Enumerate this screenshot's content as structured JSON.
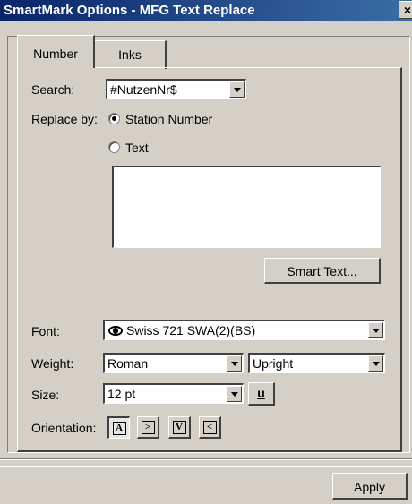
{
  "window": {
    "title": "SmartMark Options - MFG Text Replace",
    "close_label": "×"
  },
  "tabs": [
    {
      "label": "Number",
      "active": true
    },
    {
      "label": "Inks",
      "active": false
    }
  ],
  "search": {
    "label": "Search:",
    "value": "#NutzenNr$"
  },
  "replace_by": {
    "label": "Replace by:",
    "options": [
      {
        "label": "Station Number",
        "selected": true
      },
      {
        "label": "Text",
        "selected": false
      }
    ],
    "text_value": ""
  },
  "smart_text_button": "Smart Text...",
  "font": {
    "label": "Font:",
    "value": "Swiss 721 SWA(2)(BS)",
    "icon": "eye-icon"
  },
  "weight": {
    "label": "Weight:",
    "value": "Roman",
    "style_value": "Upright"
  },
  "size": {
    "label": "Size:",
    "value": "12 pt",
    "underline_label": "u"
  },
  "orientation": {
    "label": "Orientation:",
    "buttons": [
      {
        "glyph": "A",
        "name": "orientation-up",
        "pressed": true
      },
      {
        "glyph": ">",
        "name": "orientation-right",
        "pressed": false
      },
      {
        "glyph": "V",
        "name": "orientation-down",
        "pressed": false
      },
      {
        "glyph": "<",
        "name": "orientation-left",
        "pressed": false
      }
    ]
  },
  "apply_button": "Apply"
}
